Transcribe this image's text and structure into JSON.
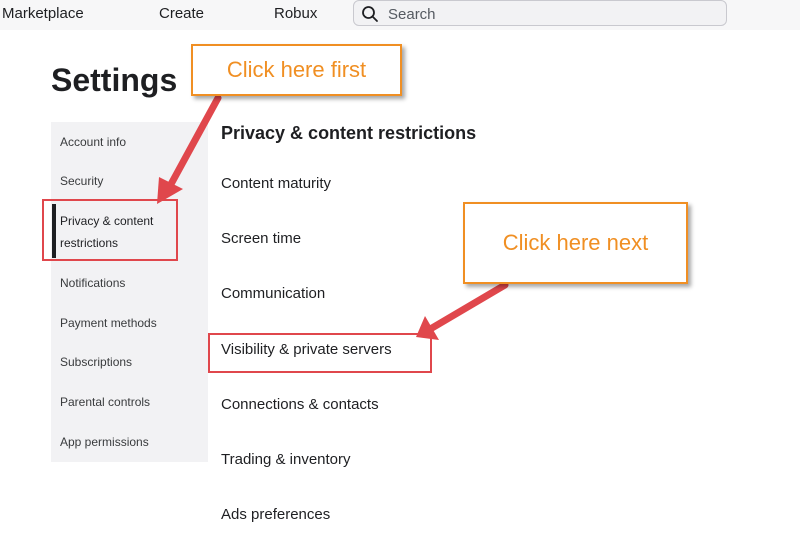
{
  "topnav": {
    "items": [
      "Marketplace",
      "Create",
      "Robux"
    ],
    "search_placeholder": "Search"
  },
  "page": {
    "title": "Settings"
  },
  "sidebar": {
    "items": [
      {
        "label": "Account info"
      },
      {
        "label": "Security"
      },
      {
        "label_line1": "Privacy & content",
        "label_line2": "restrictions",
        "active": true
      },
      {
        "label": "Notifications"
      },
      {
        "label": "Payment methods"
      },
      {
        "label": "Subscriptions"
      },
      {
        "label": "Parental controls"
      },
      {
        "label": "App permissions"
      }
    ]
  },
  "main": {
    "section_title": "Privacy & content restrictions",
    "items": [
      {
        "label": "Content maturity"
      },
      {
        "label": "Screen time"
      },
      {
        "label": "Communication"
      },
      {
        "label": "Visibility & private servers"
      },
      {
        "label": "Connections & contacts"
      },
      {
        "label": "Trading & inventory"
      },
      {
        "label": "Ads preferences"
      }
    ]
  },
  "annotations": {
    "callout_first": "Click here first",
    "callout_next": "Click here next",
    "callout_color": "#f08f23",
    "highlight_color": "#e0474c"
  },
  "icons": {
    "search": "search-icon"
  }
}
